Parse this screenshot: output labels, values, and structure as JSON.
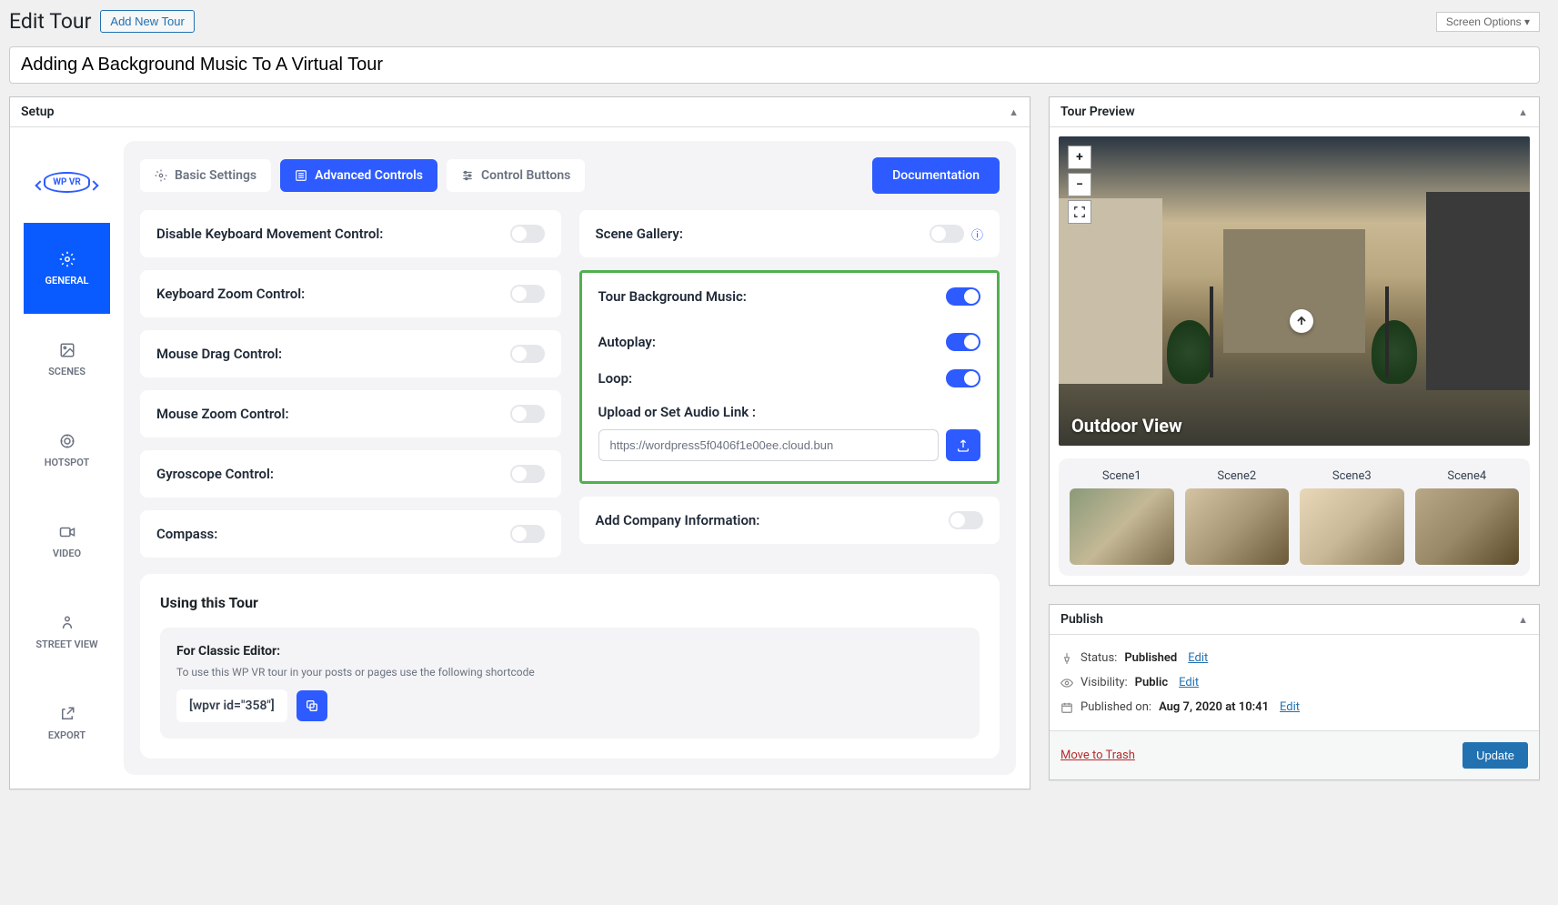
{
  "header": {
    "title": "Edit Tour",
    "add_new": "Add New Tour",
    "screen_options": "Screen Options ▾"
  },
  "post_title": "Adding A Background Music To A Virtual Tour",
  "setup": {
    "panel_title": "Setup",
    "logo_text": "WP VR",
    "vtabs": [
      {
        "id": "general",
        "label": "GENERAL"
      },
      {
        "id": "scenes",
        "label": "SCENES"
      },
      {
        "id": "hotspot",
        "label": "HOTSPOT"
      },
      {
        "id": "video",
        "label": "VIDEO"
      },
      {
        "id": "streetview",
        "label": "STREET VIEW"
      },
      {
        "id": "export",
        "label": "EXPORT"
      }
    ],
    "htabs": {
      "basic": "Basic Settings",
      "advanced": "Advanced Controls",
      "control": "Control Buttons"
    },
    "documentation": "Documentation",
    "left_opts": [
      "Disable Keyboard Movement Control:",
      "Keyboard Zoom Control:",
      "Mouse Drag Control:",
      "Mouse Zoom Control:",
      "Gyroscope Control:",
      "Compass:"
    ],
    "right": {
      "scene_gallery": "Scene Gallery:",
      "bg_music": "Tour Background Music:",
      "autoplay": "Autoplay:",
      "loop": "Loop:",
      "upload_label": "Upload or Set Audio Link :",
      "audio_url": "https://wordpress5f0406f1e00ee.cloud.bun",
      "company": "Add Company Information:"
    }
  },
  "using": {
    "title": "Using this Tour",
    "classic_title": "For Classic Editor:",
    "classic_desc": "To use this WP VR tour in your posts or pages use the following shortcode",
    "shortcode": "[wpvr id=\"358\"]"
  },
  "preview": {
    "panel_title": "Tour Preview",
    "scene_name": "Outdoor View",
    "scenes": [
      "Scene1",
      "Scene2",
      "Scene3",
      "Scene4"
    ]
  },
  "publish": {
    "panel_title": "Publish",
    "status_label": "Status:",
    "status_value": "Published",
    "visibility_label": "Visibility:",
    "visibility_value": "Public",
    "published_label": "Published on:",
    "published_value": "Aug 7, 2020 at 10:41",
    "edit": "Edit",
    "trash": "Move to Trash",
    "update": "Update"
  }
}
